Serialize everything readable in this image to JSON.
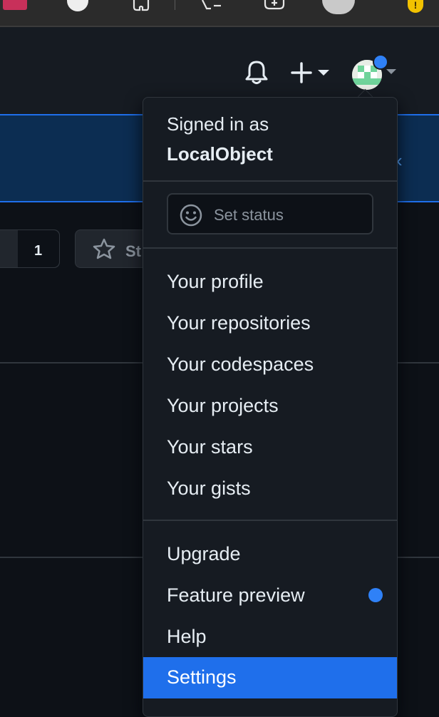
{
  "header": {
    "notifications_icon": "bell-icon",
    "create_icon": "plus-icon",
    "avatar_icon": "avatar"
  },
  "repo": {
    "count_value": "1",
    "star_label": "St"
  },
  "menu": {
    "signed_in_as": "Signed in as",
    "username": "LocalObject",
    "set_status": "Set status",
    "profile_items": [
      "Your profile",
      "Your repositories",
      "Your codespaces",
      "Your projects",
      "Your stars",
      "Your gists"
    ],
    "upgrade": "Upgrade",
    "feature_preview": "Feature preview",
    "help": "Help",
    "settings": "Settings"
  },
  "colors": {
    "background": "#0d1117",
    "header": "#161b22",
    "accent": "#1f6feb",
    "badge": "#2f81f7",
    "border": "#30363d"
  }
}
